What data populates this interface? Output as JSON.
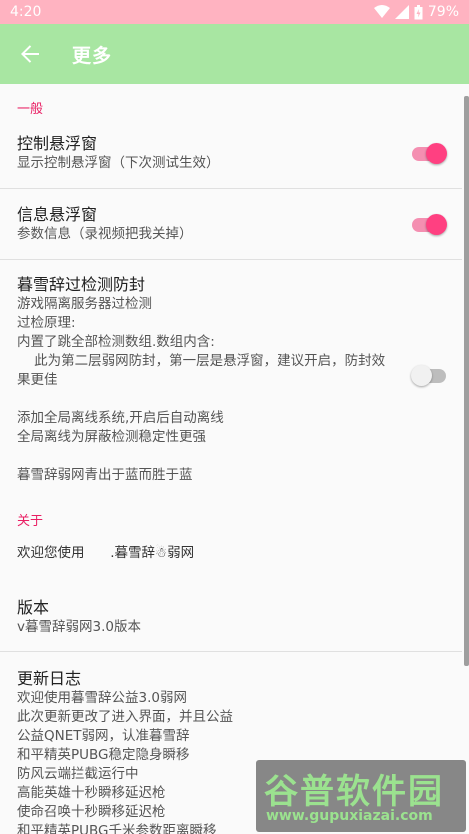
{
  "status_bar": {
    "time": "4:20",
    "battery": "79%"
  },
  "app_bar": {
    "title": "更多"
  },
  "colors": {
    "accent": "#e91e63",
    "switch_on": "#ff4081",
    "app_bar": "#a8e6a2",
    "status_bar": "#ffb3c1"
  },
  "sections": {
    "general": {
      "header": "一般",
      "control_window": {
        "title": "控制悬浮窗",
        "summary": "显示控制悬浮窗（下次测试生效）",
        "enabled": true
      },
      "info_window": {
        "title": "信息悬浮窗",
        "summary": "参数信息（录视频把我关掉）",
        "enabled": true
      },
      "anti_ban": {
        "title": "暮雪辞过检测防封",
        "lines": [
          "游戏隔离服务器过检测",
          "过检原理:",
          "内置了跳全部检测数组.数组内含:",
          "    此为第二层弱网防封，第一层是悬浮窗，建议开启，防封效",
          "果更佳",
          "",
          "添加全局离线系统,开启后自动离线",
          "全局离线为屏蔽检测稳定性更强",
          "",
          "暮雪辞弱网青出于蓝而胜于蓝"
        ],
        "enabled": false
      }
    },
    "about": {
      "header": "关于",
      "welcome": "欢迎您使用      .暮雪辞☃弱网",
      "version": {
        "title": "版本",
        "summary": "v暮雪辞弱网3.0版本"
      },
      "changelog": {
        "title": "更新日志",
        "lines": [
          "欢迎使用暮雪辞公益3.0弱网",
          "此次更新更改了进入界面，并且公益",
          "公益QNET弱网，认准暮雪辞",
          "和平精英PUBG稳定隐身瞬移",
          "防风云端拦截运行中",
          "高能英雄十秒瞬移延迟枪",
          "使命召唤十秒瞬移延迟枪",
          "和平精英PUBG千米参数距离瞬移"
        ]
      }
    }
  },
  "watermark": {
    "logo_text": "谷普软件园",
    "url": "www.gupuxiazai.com"
  }
}
